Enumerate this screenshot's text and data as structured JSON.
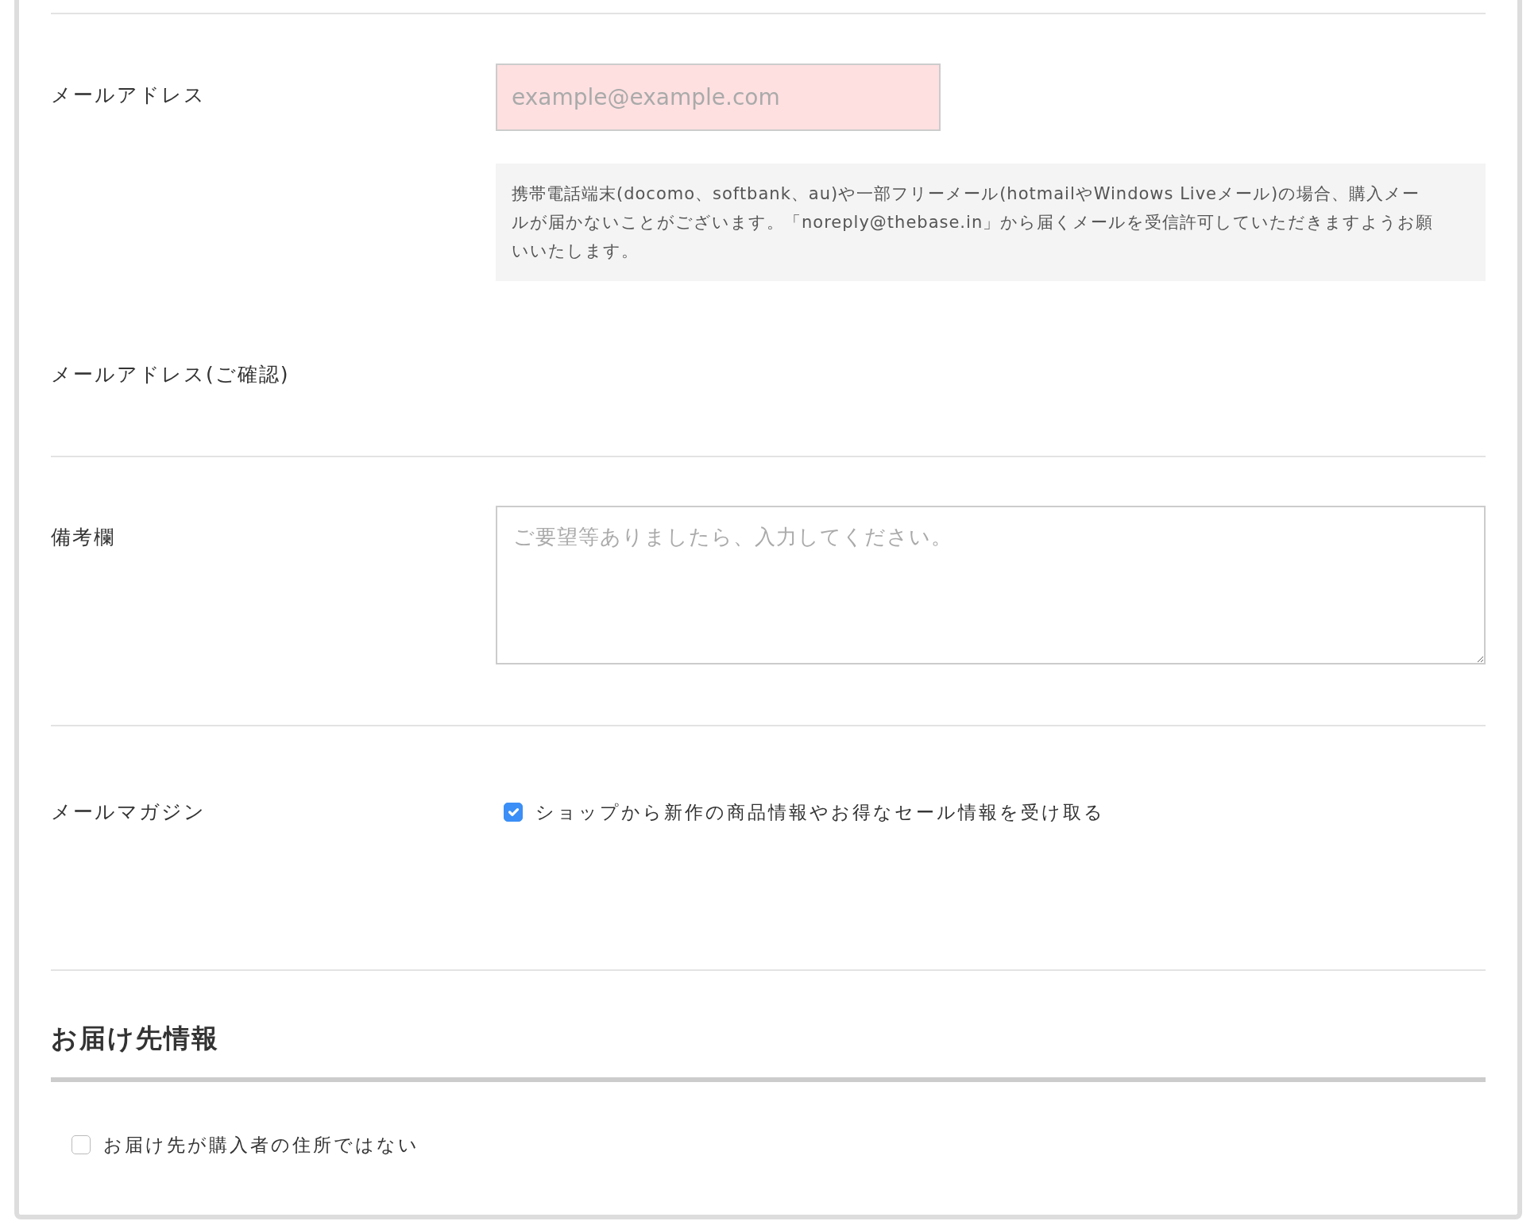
{
  "email": {
    "label": "メールアドレス",
    "placeholder": "example@example.com",
    "invalid": true,
    "note": "携帯電話端末(docomo、softbank、au)や一部フリーメール(hotmailやWindows Liveメール)の場合、購入メールが届かないことがございます。「noreply@thebase.in」から届くメールを受信許可していただきますようお願いいたします。"
  },
  "email_confirm": {
    "label": "メールアドレス(ご確認)"
  },
  "remarks": {
    "label": "備考欄",
    "placeholder": "ご要望等ありましたら、入力してください。"
  },
  "newsletter": {
    "label": "メールマガジン",
    "option": "ショップから新作の商品情報やお得なセール情報を受け取る",
    "checked": true
  },
  "shipping": {
    "heading": "お届け先情報",
    "option": "お届け先が購入者の住所ではない",
    "checked": false
  }
}
